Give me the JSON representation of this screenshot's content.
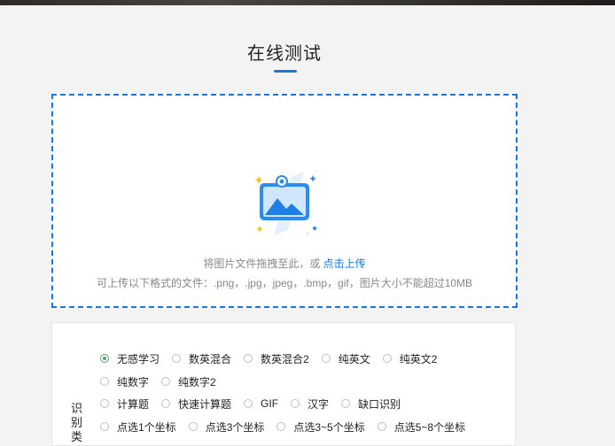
{
  "header": {
    "title": "在线测试"
  },
  "upload": {
    "hint_text": "将图片文件拖拽至此，或 ",
    "link_text": "点击上传",
    "formats_text": "可上传以下格式的文件：.png，.jpg，jpeg，.bmp，gif，图片大小不能超过10MB",
    "icon": "image-upload-icon"
  },
  "options": {
    "label": "识别类",
    "selected": "无感学习",
    "rows": [
      [
        "无感学习",
        "数英混合",
        "数英混合2",
        "纯英文",
        "纯英文2"
      ],
      [
        "纯数字",
        "纯数字2"
      ],
      [
        "计算题",
        "快速计算题",
        "GIF",
        "汉字",
        "缺口识别"
      ],
      [
        "点选1个坐标",
        "点选3个坐标",
        "点选3~5个坐标",
        "点选5~8个坐标"
      ]
    ]
  },
  "colors": {
    "accent": "#1677e0",
    "radio_checked": "#52a56a",
    "background": "#f3f3f3"
  }
}
